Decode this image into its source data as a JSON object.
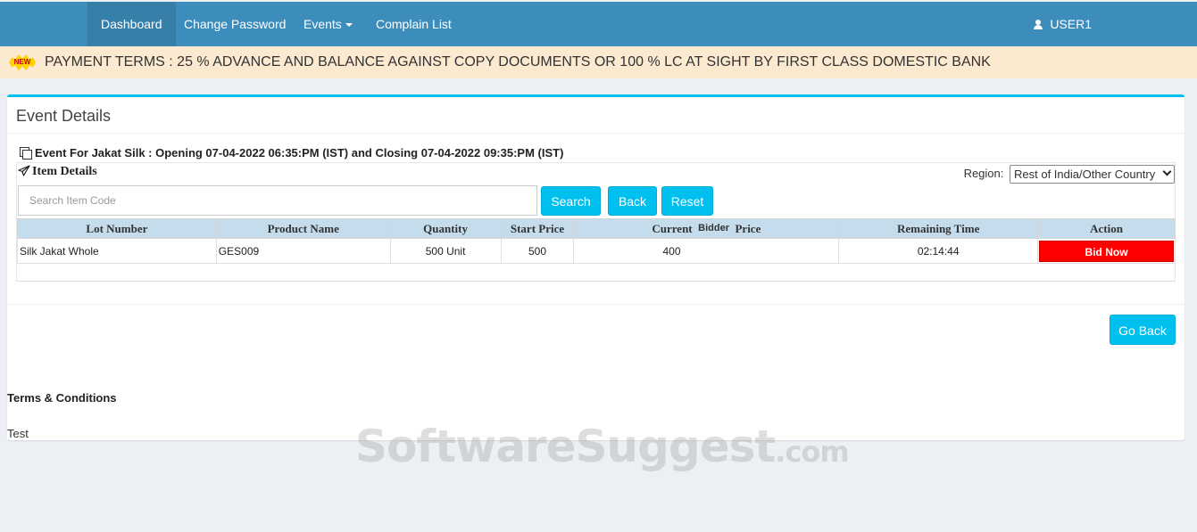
{
  "nav": {
    "items": [
      {
        "label": "Dashboard",
        "active": true
      },
      {
        "label": "Change Password"
      },
      {
        "label": "Events",
        "dropdown": true
      },
      {
        "label": "Complain List"
      }
    ],
    "user": "USER1",
    "bg_color": "#3c8dbc"
  },
  "announcement": {
    "badge": "NEW",
    "text": "PAYMENT TERMS : 25 % ADVANCE AND BALANCE AGAINST COPY DOCUMENTS OR 100 % LC AT SIGHT BY FIRST CLASS DOMESTIC BANK"
  },
  "box": {
    "title": "Event Details",
    "event_line": "Event For Jakat Silk : Opening 07-04-2022 06:35:PM (IST) and Closing 07-04-2022 09:35:PM (IST)",
    "item_details_title": "Item Details",
    "region_label": "Region:",
    "region_value": "Rest of India/Other Country",
    "search_placeholder": "Search Item Code",
    "search_button": "Search",
    "back_button": "Back",
    "reset_button": "Reset",
    "table": {
      "headers": [
        "Lot Number",
        "Product Name",
        "Quantity",
        "Start Price",
        "Current",
        "Bidder",
        "Price",
        "Remaining Time",
        "Action"
      ],
      "rows": [
        {
          "lot": "Silk Jakat Whole",
          "product": "GES009",
          "quantity": "500 Unit",
          "start_price": "500",
          "current_price": "400",
          "remaining": "02:14:44",
          "action": "Bid Now"
        }
      ]
    },
    "go_back_button": "Go Back",
    "terms_title": "Terms & Conditions",
    "terms_text": "Test"
  },
  "watermark": {
    "main": "SoftwareSuggest",
    "domain": ".com"
  },
  "colors": {
    "accent": "#00c0ef",
    "danger": "#ff0000",
    "header_row": "#c5dcec"
  }
}
